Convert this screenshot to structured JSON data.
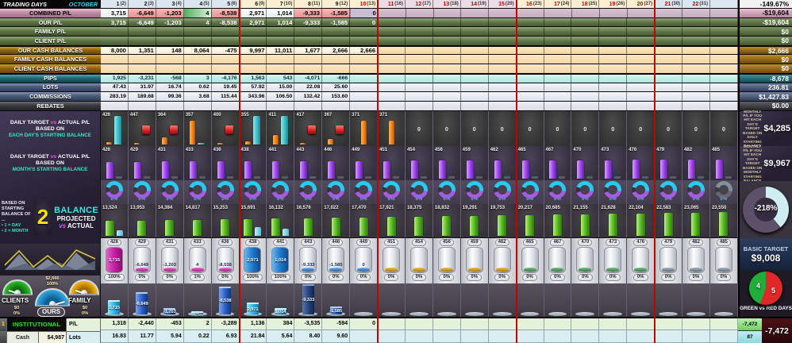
{
  "title": {
    "label": "TRADING  DAYS",
    "month": "OCTOBER"
  },
  "columns": [
    {
      "day": "1",
      "date": "(2)",
      "red": false
    },
    {
      "day": "2",
      "date": "(3)",
      "red": false
    },
    {
      "day": "3",
      "date": "(4)",
      "red": false
    },
    {
      "day": "4",
      "date": "(5)",
      "red": false
    },
    {
      "day": "5",
      "date": "(6)",
      "red": false
    },
    {
      "day": "6",
      "date": "(9)",
      "red": false
    },
    {
      "day": "7",
      "date": "(10)",
      "red": false
    },
    {
      "day": "8",
      "date": "(11)",
      "red": false
    },
    {
      "day": "9",
      "date": "(12)",
      "red": false
    },
    {
      "day": "10",
      "date": "(13)",
      "red": true
    },
    {
      "day": "11",
      "date": "(16)",
      "red": true
    },
    {
      "day": "12",
      "date": "(17)",
      "red": true
    },
    {
      "day": "13",
      "date": "(18)",
      "red": true
    },
    {
      "day": "14",
      "date": "(19)",
      "red": true
    },
    {
      "day": "15",
      "date": "(20)",
      "red": true
    },
    {
      "day": "16",
      "date": "(23)",
      "red": true
    },
    {
      "day": "17",
      "date": "(24)",
      "red": true
    },
    {
      "day": "18",
      "date": "(25)",
      "red": true
    },
    {
      "day": "19",
      "date": "(26)",
      "red": true
    },
    {
      "day": "20",
      "date": "(27)",
      "red": true
    },
    {
      "day": "21",
      "date": "(30)",
      "red": true
    },
    {
      "day": "22",
      "date": "(31)",
      "red": true
    },
    {
      "day": "",
      "date": "",
      "red": false
    }
  ],
  "table": {
    "header_summary": "-149.67%",
    "rows": [
      {
        "key": "combined",
        "label": "COMBINED P/L",
        "summary": "-$19,604",
        "sep": false,
        "values": [
          "3,715",
          "-6,649",
          "-1,203",
          "4",
          "-8,538",
          "2,971",
          "1,014",
          "-9,333",
          "-1,585",
          "0"
        ]
      },
      {
        "key": "our",
        "label": "OUR P/L",
        "summary": "-$19,604",
        "sep": false,
        "values": [
          "3,715",
          "-6,649",
          "-1,203",
          "4",
          "-8,538",
          "2,971",
          "1,014",
          "-9,333",
          "-1,585",
          "0"
        ]
      },
      {
        "key": "family",
        "label": "FAMILY P/L",
        "summary": "$0",
        "sep": false,
        "values": []
      },
      {
        "key": "client",
        "label": "CLIENT P/L",
        "summary": "$0",
        "sep": false,
        "values": []
      },
      {
        "key": "our_cash",
        "label": "OUR CASH BALANCES",
        "summary": "$2,666",
        "sep": true,
        "values": [
          "8,000",
          "1,351",
          "148",
          "8,064",
          "-475",
          "9,997",
          "11,011",
          "1,677",
          "2,666",
          "2,666"
        ]
      },
      {
        "key": "family_cash",
        "label": "FAMILY CASH BALANCES",
        "summary": "$0",
        "sep": false,
        "values": []
      },
      {
        "key": "client_cash",
        "label": "CLIENT CASH BALANCES",
        "summary": "$0",
        "sep": false,
        "values": []
      },
      {
        "key": "pips",
        "label": "PIPS",
        "summary": "-8,678",
        "sep": true,
        "values": [
          "1,925",
          "-3,231",
          "-568",
          "3",
          "-4,176",
          "1,563",
          "543",
          "-4,071",
          "-666"
        ]
      },
      {
        "key": "lots",
        "label": "LOTS",
        "summary": "236.81",
        "sep": false,
        "values": [
          "47.43",
          "31.97",
          "16.74",
          "0.62",
          "19.45",
          "57.92",
          "15.00",
          "22.08",
          "25.60"
        ]
      },
      {
        "key": "commissions",
        "label": "COMMISSIONS",
        "summary": "$1,427.83",
        "sep": false,
        "values": [
          "283.19",
          "189.68",
          "99.36",
          "3.68",
          "115.44",
          "343.96",
          "106.50",
          "132.42",
          "153.60"
        ]
      },
      {
        "key": "rebates",
        "label": "REBATES",
        "summary": "$0.00",
        "sep": false,
        "values": []
      }
    ]
  },
  "labels": {
    "c1": {
      "l1": "DAILY TARGET",
      "vs": "vs",
      "l2": "ACTUAL P/L",
      "l3": "BASED ON",
      "l4": "EACH DAY'S STARTING BALANCE"
    },
    "c2": {
      "l1": "DAILY TARGET",
      "vs": "vs",
      "l2": "ACTUAL P/L",
      "l3": "BASED ON",
      "l4": "MONTH'S STARTING BALANCE"
    }
  },
  "notes": {
    "daily": {
      "text": "MONTHLY P/L IF YOU HIT EACH DAY'S TARGET BASED ON DAILY STARTING BALANCE",
      "value": "$4,285"
    },
    "monthly": {
      "text": "MONTHLY P/L IF YOU HIT EACH DAY'S TARGET BASED ON MONTHLY STARTING BALANCE",
      "value": "$9,967"
    }
  },
  "charts": {
    "daily_day": {
      "targets": [
        "426",
        "447",
        "364",
        "357",
        "400",
        "355",
        "411",
        "417",
        "367",
        "371",
        "371",
        "0",
        "0",
        "0",
        "0",
        "0",
        "0",
        "0",
        "0",
        "0",
        "0",
        "0",
        "0"
      ]
    },
    "daily_month": {
      "targets": [
        "426",
        "429",
        "431",
        "433",
        "436",
        "438",
        "441",
        "443",
        "446",
        "449",
        "451",
        "454",
        "456",
        "459",
        "462",
        "465",
        "467",
        "470",
        "473",
        "476",
        "479",
        "482",
        "485"
      ]
    },
    "gauge_pcts": [
      "0%",
      "0%",
      "0%",
      "0%",
      "0%",
      "0%",
      "0%",
      "0%",
      "0%",
      "0%",
      "0%",
      "0%",
      "0%",
      "0%",
      "0%",
      "0%",
      "0%",
      "0%",
      "0%",
      "0%",
      "0%",
      "0%",
      "0%"
    ],
    "balance": {
      "values": [
        "13,524",
        "13,953",
        "14,384",
        "14,817",
        "15,253",
        "15,691",
        "16,132",
        "16,576",
        "17,022",
        "17,470",
        "17,921",
        "18,375",
        "18,832",
        "19,291",
        "19,753",
        "20,217",
        "20,685",
        "21,155",
        "21,628",
        "22,104",
        "22,583",
        "23,065",
        "23,550"
      ],
      "actual_cols": [
        0,
        5,
        6
      ]
    },
    "cylinders": {
      "values": [
        "3,715",
        "-6,649",
        "-1,203",
        "4",
        "-8,538",
        "2,971",
        "1,014",
        "-9,333",
        "-1,585",
        "0"
      ],
      "pcts": [
        "100%",
        "0%",
        "0%",
        "1%",
        "0%",
        "100%",
        "100%",
        "0%",
        "0%",
        "0%",
        "0%",
        "0%",
        "0%",
        "0%",
        "0%",
        "0%",
        "0%",
        "0%",
        "0%",
        "0%",
        "0%",
        "0%",
        "0%"
      ],
      "fill": {
        "0": "magenta",
        "5": "blue",
        "6": "blue"
      }
    },
    "bars": {
      "values": [
        "3,715",
        "-6,649",
        "-1,203",
        "4",
        "-8,538",
        "2,971",
        "1,014",
        "-9,333",
        "-1,585"
      ]
    }
  },
  "balance_panel": {
    "l1": "BASED ON",
    "l2": "STARTING",
    "l3": "BALANCE OF ...",
    "opt1": "• 1 = DAY",
    "opt2": "• 2 = MONTH",
    "mode": "2",
    "title": "BALANCE",
    "sub1": "PROJECTED",
    "vs": "vs",
    "sub2": "ACTUAL"
  },
  "gauges": {
    "ours_above_value": "$2,666",
    "ours_above_pct": "100%",
    "clients": {
      "label": "CLIENTS",
      "value": "$0",
      "pct": "0%"
    },
    "ours": {
      "label": "OURS"
    },
    "family": {
      "label": "FAMILY",
      "value": "$0",
      "pct": "0%"
    }
  },
  "right": {
    "big_donut_pct": "-218%",
    "basic_target": {
      "label": "BASIC TARGET",
      "value": "$9,008"
    },
    "pie": {
      "green": "4",
      "red": "5",
      "caption": "GREEN vs RED DAYS"
    },
    "totals": {
      "pl": "-7,472",
      "pips": "87",
      "grand": "-7,472"
    }
  },
  "bottom": {
    "row_num": "1",
    "account": "INSTITUTIONAL",
    "pl_label": "P/L",
    "cash_label": "Cash",
    "cash_value": "$4,987",
    "lots_label": "Lots",
    "pl_values": [
      "1,318",
      "-2,440",
      "-453",
      "2",
      "-3,289",
      "1,136",
      "384",
      "-3,535",
      "-594",
      "0"
    ],
    "lots_values": [
      "16.83",
      "11.77",
      "5.94",
      "0.22",
      "6.93",
      "21.84",
      "5.64",
      "8.40",
      "9.60"
    ]
  }
}
